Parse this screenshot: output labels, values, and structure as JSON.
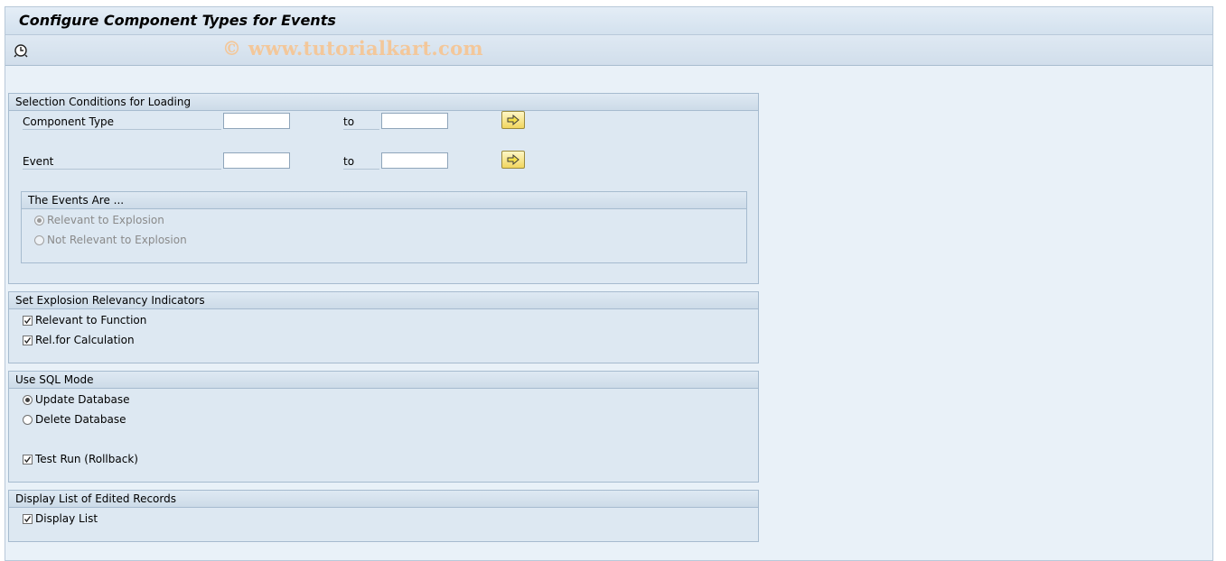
{
  "window": {
    "title": "Configure Component Types for Events",
    "watermark": "© www.tutorialkart.com"
  },
  "toolbar": {
    "execute_icon": "execute-clock-icon"
  },
  "selection": {
    "header": "Selection Conditions for Loading",
    "component_type": {
      "label": "Component Type",
      "from": "",
      "to_label": "to",
      "to": ""
    },
    "event": {
      "label": "Event",
      "from": "",
      "to_label": "to",
      "to": ""
    },
    "multi_select_icon": "arrow-right-icon",
    "events_group": {
      "header": "The Events Are ...",
      "relevant": "Relevant to Explosion",
      "not_relevant": "Not Relevant to Explosion",
      "selected": "relevant"
    }
  },
  "indicators": {
    "header": "Set Explosion Relevancy Indicators",
    "relevant_to_function": {
      "label": "Relevant to Function",
      "checked": true
    },
    "rel_for_calculation": {
      "label": "Rel.for Calculation",
      "checked": true
    }
  },
  "sql_mode": {
    "header": "Use SQL Mode",
    "update_database": "Update Database",
    "delete_database": "Delete Database",
    "selected": "update",
    "test_run": {
      "label": "Test Run (Rollback)",
      "checked": true
    }
  },
  "display": {
    "header": "Display List of Edited Records",
    "display_list": {
      "label": "Display List",
      "checked": true
    }
  },
  "colors": {
    "background": "#e9f1f8",
    "group_background": "#dde8f2",
    "button_yellow": "#f1d65f"
  }
}
